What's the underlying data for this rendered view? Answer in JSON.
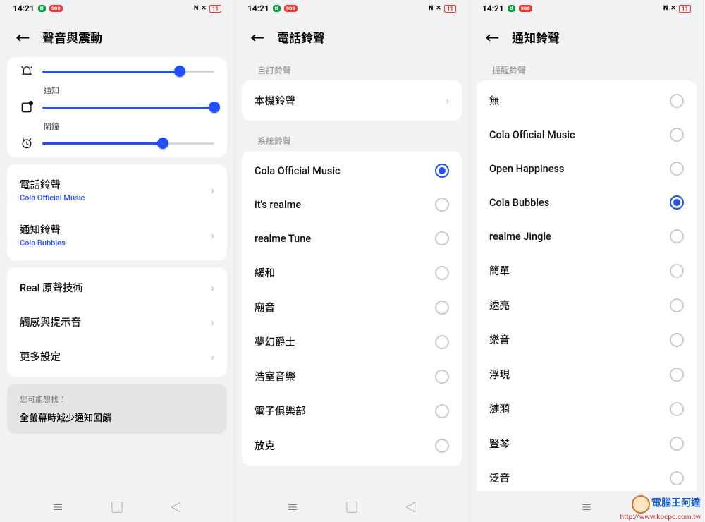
{
  "status": {
    "time": "14:21",
    "nfc": "N",
    "sig": "✕",
    "battery": "11"
  },
  "p1": {
    "title": "聲音與震動",
    "labels": {
      "notify": "通知",
      "alarm": "鬧鐘"
    },
    "sliders": {
      "ring": 80,
      "notify": 100,
      "alarm": 70
    },
    "ringtone": {
      "t": "電話鈴聲",
      "s": "Cola Official Music"
    },
    "notif": {
      "t": "通知鈴聲",
      "s": "Cola Bubbles"
    },
    "rows": [
      "Real 原聲技術",
      "觸感與提示音",
      "更多設定"
    ],
    "tip": {
      "h": "您可能想找：",
      "t": "全螢幕時減少通知回饋"
    }
  },
  "p2": {
    "title": "電話鈴聲",
    "custom_h": "自訂鈴聲",
    "local": "本機鈴聲",
    "sys_h": "系統鈴聲",
    "items": [
      {
        "t": "Cola Official Music",
        "on": true
      },
      {
        "t": "it's realme",
        "on": false
      },
      {
        "t": "realme Tune",
        "on": false
      },
      {
        "t": "緩和",
        "on": false
      },
      {
        "t": "廟音",
        "on": false
      },
      {
        "t": "夢幻爵士",
        "on": false
      },
      {
        "t": "浩室音樂",
        "on": false
      },
      {
        "t": "電子俱樂部",
        "on": false
      },
      {
        "t": "放克",
        "on": false
      }
    ]
  },
  "p3": {
    "title": "通知鈴聲",
    "h": "提醒鈴聲",
    "items": [
      {
        "t": "無",
        "on": false
      },
      {
        "t": "Cola Official Music",
        "on": false
      },
      {
        "t": "Open Happiness",
        "on": false
      },
      {
        "t": "Cola Bubbles",
        "on": true
      },
      {
        "t": "realme Jingle",
        "on": false
      },
      {
        "t": "簡單",
        "on": false
      },
      {
        "t": "透亮",
        "on": false
      },
      {
        "t": "樂音",
        "on": false
      },
      {
        "t": "浮現",
        "on": false
      },
      {
        "t": "漣漪",
        "on": false
      },
      {
        "t": "豎琴",
        "on": false
      },
      {
        "t": "泛音",
        "on": false
      }
    ]
  },
  "watermark": {
    "brand": "電腦王阿達",
    "url": "http://www.kocpc.com.tw"
  }
}
